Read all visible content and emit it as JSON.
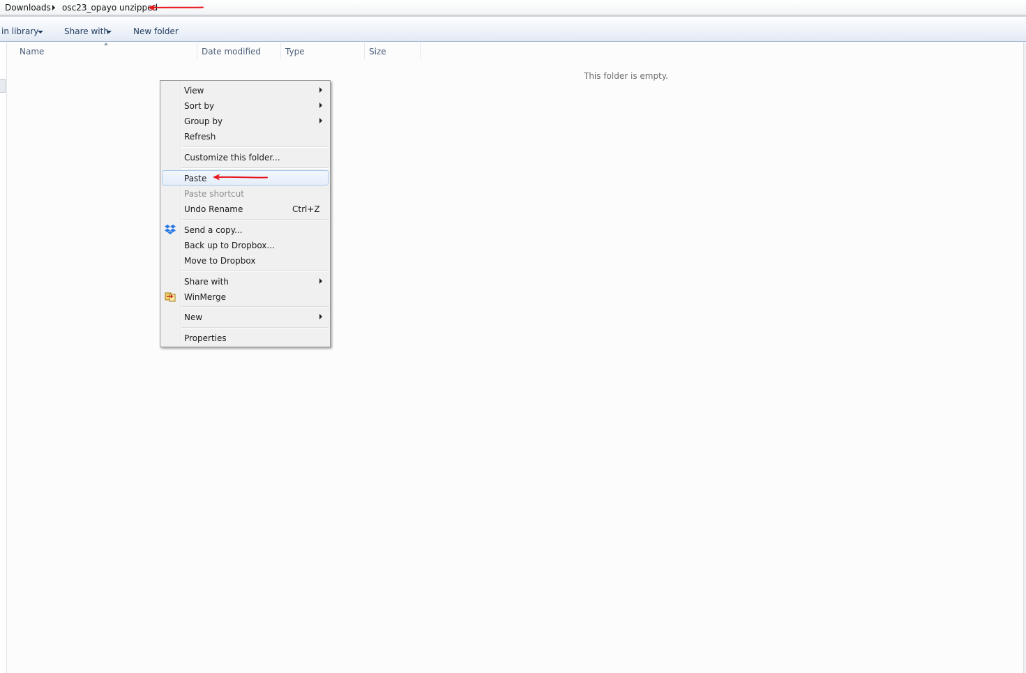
{
  "address": {
    "crumbs": [
      "Downloads",
      "osc23_opayo unzipped"
    ]
  },
  "toolbar": {
    "include_library": "in library",
    "share_with": "Share with",
    "new_folder": "New folder"
  },
  "columns": {
    "name": "Name",
    "date_modified": "Date modified",
    "type": "Type",
    "size": "Size"
  },
  "content": {
    "empty_message": "This folder is empty."
  },
  "context_menu": {
    "view": "View",
    "sort_by": "Sort by",
    "group_by": "Group by",
    "refresh": "Refresh",
    "customize": "Customize this folder...",
    "paste": "Paste",
    "paste_shortcut": "Paste shortcut",
    "undo_rename": "Undo Rename",
    "undo_rename_shortcut": "Ctrl+Z",
    "send_copy": "Send a copy...",
    "backup_dropbox": "Back up to Dropbox...",
    "move_dropbox": "Move to Dropbox",
    "share_with": "Share with",
    "winmerge": "WinMerge",
    "new": "New",
    "properties": "Properties"
  },
  "icons": {
    "dropbox": "dropbox-icon",
    "winmerge": "winmerge-icon"
  },
  "colors": {
    "annotation_arrow": "#e8151b",
    "highlight_border": "#a8c8eb",
    "toolbar_text": "#1e395b"
  }
}
